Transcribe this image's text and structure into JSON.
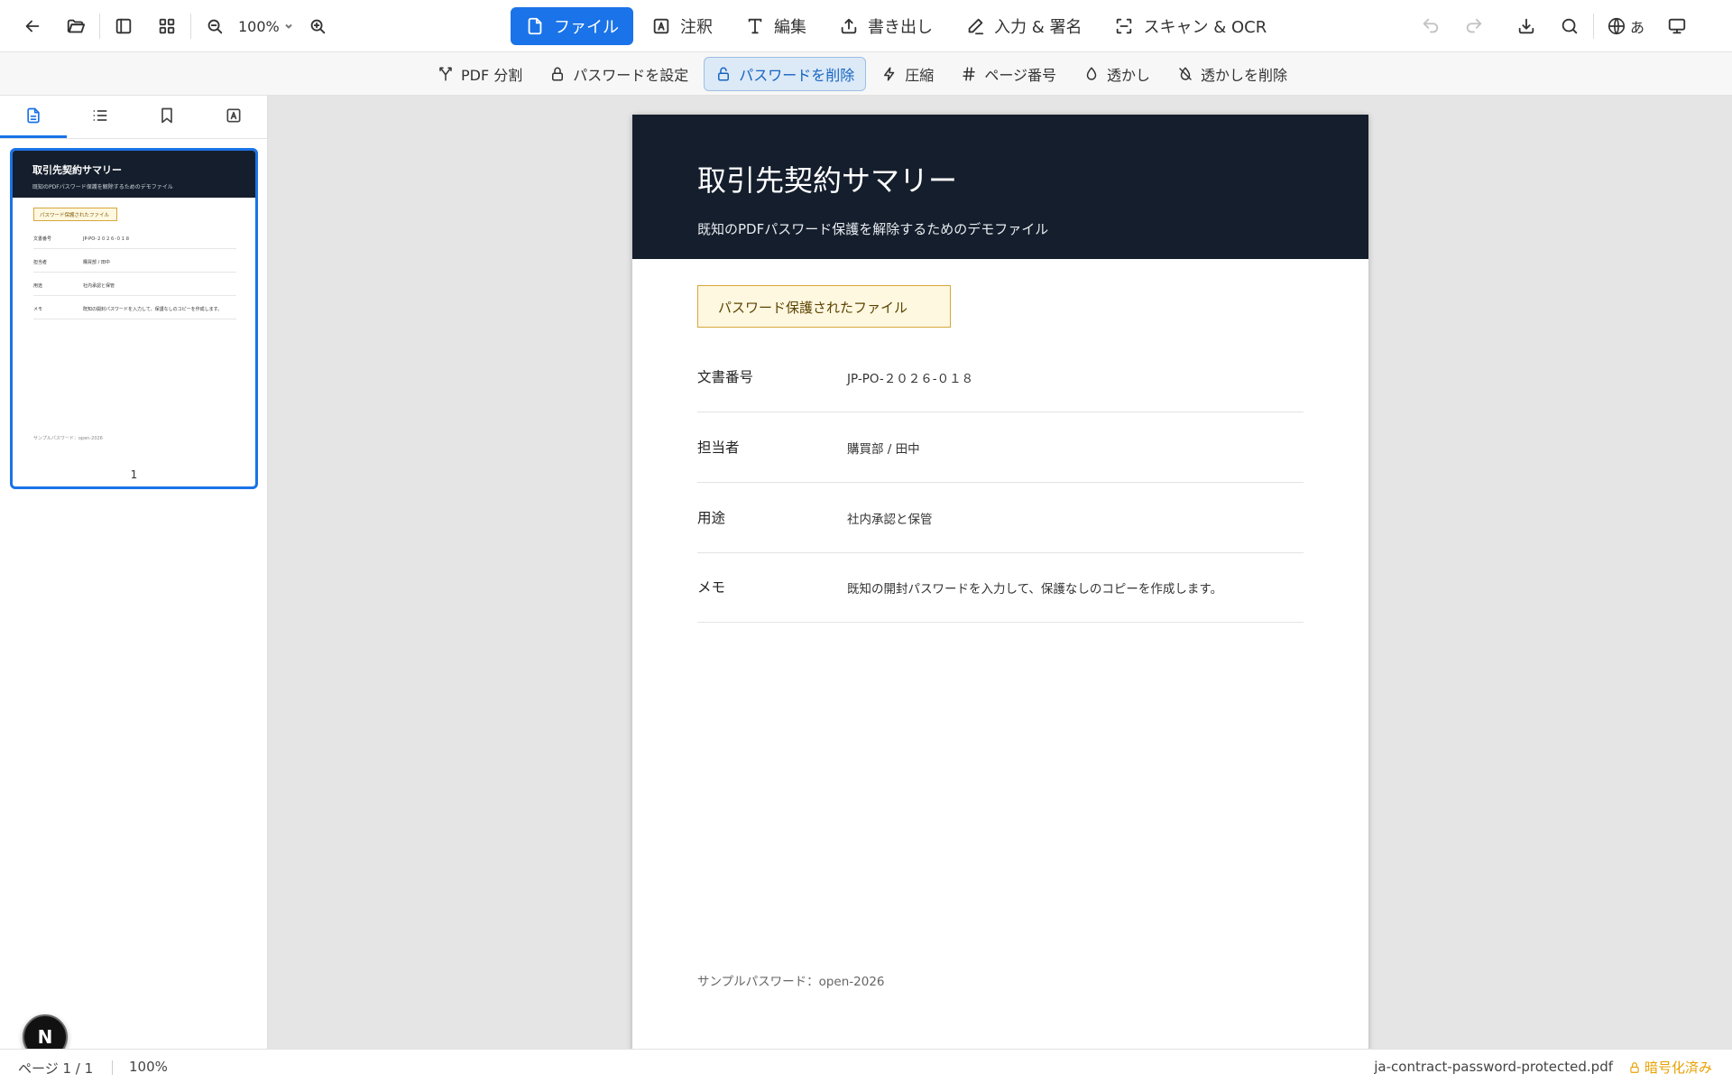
{
  "toolbar": {
    "zoom": "100%",
    "tabs": [
      {
        "label": "ファイル",
        "icon": "file-icon"
      },
      {
        "label": "注釈",
        "icon": "annotate-icon"
      },
      {
        "label": "編集",
        "icon": "text-icon"
      },
      {
        "label": "書き出し",
        "icon": "export-icon"
      },
      {
        "label": "入力 & 署名",
        "icon": "pen-icon"
      },
      {
        "label": "スキャン & OCR",
        "icon": "scan-icon"
      }
    ],
    "language": "あ"
  },
  "subtools": [
    {
      "label": "PDF 分割",
      "icon": "split-icon"
    },
    {
      "label": "パスワードを設定",
      "icon": "lock-icon"
    },
    {
      "label": "パスワードを削除",
      "icon": "unlock-icon",
      "active": true
    },
    {
      "label": "圧縮",
      "icon": "bolt-icon"
    },
    {
      "label": "ページ番号",
      "icon": "hash-icon"
    },
    {
      "label": "透かし",
      "icon": "droplet-icon"
    },
    {
      "label": "透かしを削除",
      "icon": "droplet-off-icon"
    }
  ],
  "document": {
    "title": "取引先契約サマリー",
    "subtitle": "既知のPDFパスワード保護を解除するためのデモファイル",
    "badge": "パスワード保護されたファイル",
    "rows": [
      {
        "key": "文書番号",
        "value": "JP-PO-２０２６-０１８"
      },
      {
        "key": "担当者",
        "value": "購買部 / 田中"
      },
      {
        "key": "用途",
        "value": "社内承認と保管"
      },
      {
        "key": "メモ",
        "value": "既知の開封パスワードを入力して、保護なしのコピーを作成します。"
      }
    ],
    "footer": "サンプルパスワード：open-2026"
  },
  "thumbnail": {
    "page_number": "1"
  },
  "status": {
    "page": "ページ 1 / 1",
    "zoom": "100%",
    "filename": "ja-contract-password-protected.pdf",
    "encryption": "暗号化済み"
  },
  "colors": {
    "accent": "#1a73e8",
    "header_dark": "#151e2c",
    "badge_bg": "#fff8e1",
    "badge_border": "#d6a63a",
    "encrypted": "#e8a100"
  }
}
